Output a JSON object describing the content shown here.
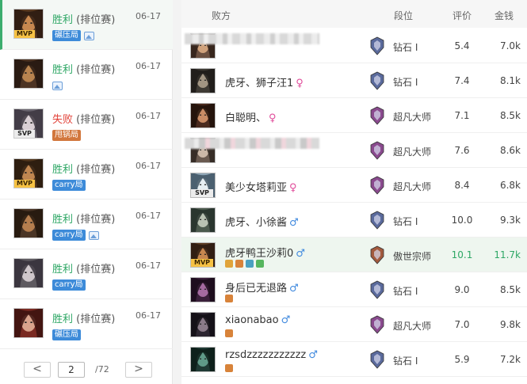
{
  "matches": [
    {
      "result": "胜利",
      "mode": "(排位赛)",
      "date": "06-17",
      "badge": "MVP",
      "tag": "碾压局",
      "has_image": true,
      "win": true,
      "active": true
    },
    {
      "result": "胜利",
      "mode": "(排位赛)",
      "date": "06-17",
      "badge": "",
      "tag": "",
      "has_image": true,
      "win": true,
      "active": false
    },
    {
      "result": "失败",
      "mode": "(排位赛)",
      "date": "06-17",
      "badge": "SVP",
      "tag": "甩锅局",
      "has_image": false,
      "win": false,
      "active": false
    },
    {
      "result": "胜利",
      "mode": "(排位赛)",
      "date": "06-17",
      "badge": "MVP",
      "tag": "carry局",
      "has_image": false,
      "win": true,
      "active": false
    },
    {
      "result": "胜利",
      "mode": "(排位赛)",
      "date": "06-17",
      "badge": "",
      "tag": "carry局",
      "has_image": true,
      "win": true,
      "active": false
    },
    {
      "result": "胜利",
      "mode": "(排位赛)",
      "date": "06-17",
      "badge": "",
      "tag": "carry局",
      "has_image": false,
      "win": true,
      "active": false
    },
    {
      "result": "胜利",
      "mode": "(排位赛)",
      "date": "06-17",
      "badge": "",
      "tag": "碾压局",
      "has_image": false,
      "win": true,
      "active": false
    }
  ],
  "pagination": {
    "prev_label": "<",
    "next_label": ">",
    "current_page": "2",
    "total_label": "/72"
  },
  "table": {
    "headers": {
      "team": "败方",
      "rank": "段位",
      "score": "评价",
      "gold": "金钱"
    },
    "players": [
      {
        "name": "",
        "gender": "",
        "rank": "钻石 I",
        "score": "5.4",
        "gold": "7.0k",
        "badge": "",
        "blurred": true
      },
      {
        "name": "虎牙、狮子汪1",
        "gender": "♀",
        "rank": "钻石 I",
        "score": "7.4",
        "gold": "8.1k",
        "badge": "",
        "blurred": false
      },
      {
        "name": "白聪明、",
        "gender": "♀",
        "rank": "超凡大师",
        "score": "7.1",
        "gold": "8.5k",
        "badge": "",
        "blurred": false
      },
      {
        "name": "",
        "gender": "",
        "rank": "超凡大师",
        "score": "7.6",
        "gold": "8.6k",
        "badge": "",
        "blurred": true
      },
      {
        "name": "美少女塔莉亚",
        "gender": "♀",
        "rank": "超凡大师",
        "score": "8.4",
        "gold": "6.8k",
        "badge": "SVP",
        "blurred": false
      },
      {
        "name": "虎牙、小徐酱",
        "gender": "♂",
        "rank": "钻石 I",
        "score": "10.0",
        "gold": "9.3k",
        "badge": "",
        "blurred": false
      },
      {
        "name": "虎牙鸭王沙莉0",
        "gender": "♂",
        "rank": "傲世宗师",
        "score": "10.1",
        "gold": "11.7k",
        "badge": "MVP",
        "blurred": false
      },
      {
        "name": "身后已无退路",
        "gender": "♂",
        "rank": "钻石 I",
        "score": "9.0",
        "gold": "8.5k",
        "badge": "",
        "blurred": false
      },
      {
        "name": "xiaonabao",
        "gender": "♂",
        "rank": "超凡大师",
        "score": "7.0",
        "gold": "9.8k",
        "badge": "",
        "blurred": false
      },
      {
        "name": "rzsdzzzzzzzzzzz",
        "gender": "♂",
        "rank": "钻石 I",
        "score": "5.9",
        "gold": "7.2k",
        "badge": "",
        "blurred": false
      }
    ]
  }
}
